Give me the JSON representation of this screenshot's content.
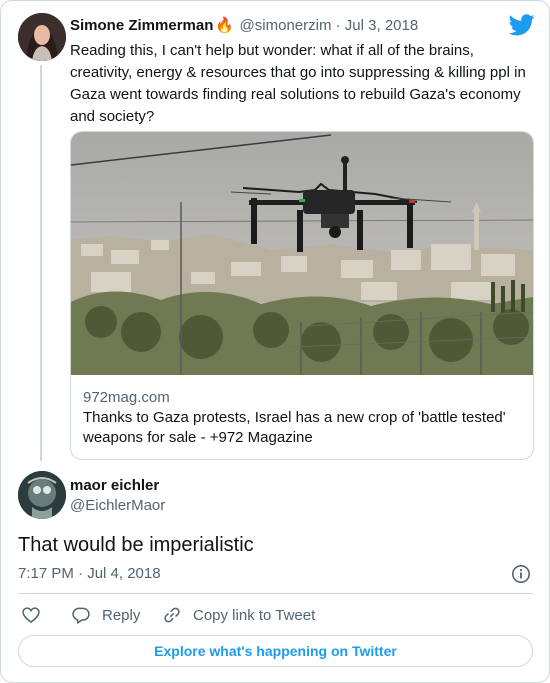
{
  "quoted_tweet": {
    "author_name": "Simone Zimmerman",
    "author_emoji": "🔥",
    "handle": "@simonerzim",
    "separator": "·",
    "date": "Jul 3, 2018",
    "text": "Reading this, I can't help but wonder: what if all of the brains, creativity, energy & resources that go into suppressing & killing ppl in Gaza went towards finding real solutions to rebuild Gaza's economy and society?",
    "link_card": {
      "domain": "972mag.com",
      "title": "Thanks to Gaza protests, Israel has a new crop of 'battle tested' weapons for sale - +972 Magazine"
    }
  },
  "reply_tweet": {
    "author_name": "maor eichler",
    "handle": "@EichlerMaor",
    "text": "That would be imperialistic",
    "timestamp": "7:17 PM · Jul 4, 2018"
  },
  "actions": {
    "like_label": "",
    "reply_label": "Reply",
    "copy_link_label": "Copy link to Tweet"
  },
  "explore_button_label": "Explore what's happening on Twitter",
  "icons": {
    "brand": "twitter-bird-icon",
    "info": "info-icon",
    "like": "heart-icon",
    "reply": "reply-bubble-icon",
    "copy": "link-icon"
  },
  "colors": {
    "twitter_blue": "#1d9bf0",
    "text_primary": "#0f1419",
    "text_secondary": "#536471",
    "border": "#cfd9de"
  }
}
